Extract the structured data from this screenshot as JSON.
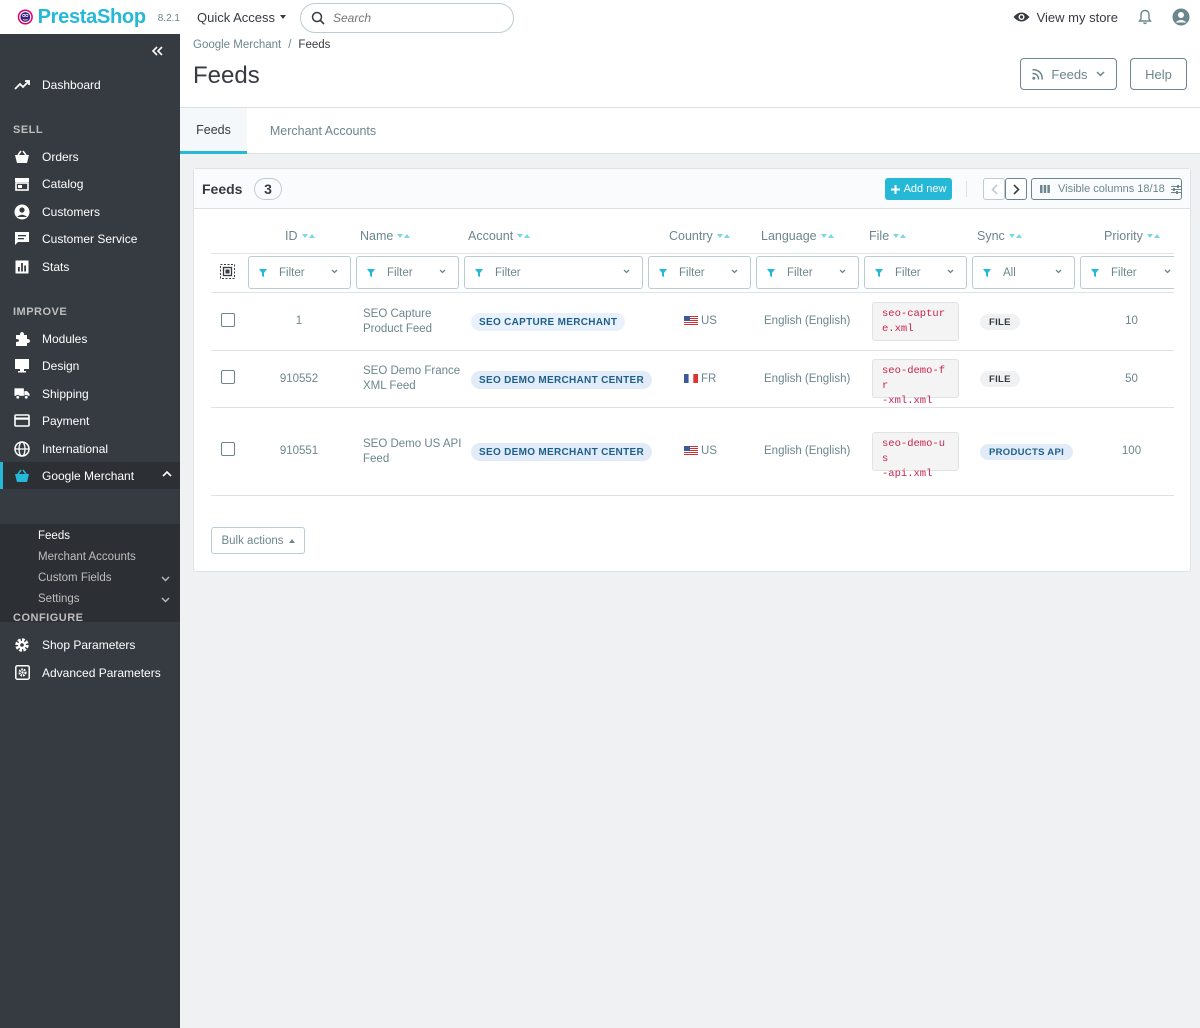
{
  "header": {
    "logo_text": "PrestaShop",
    "version": "8.2.1",
    "quick_access_label": "Quick Access",
    "search_placeholder": "Search",
    "view_store_label": "View my store"
  },
  "sidebar": {
    "dashboard": "Dashboard",
    "sections": {
      "sell": "SELL",
      "improve": "IMPROVE",
      "configure": "CONFIGURE"
    },
    "sell_items": [
      "Orders",
      "Catalog",
      "Customers",
      "Customer Service",
      "Stats"
    ],
    "improve_items": [
      "Modules",
      "Design",
      "Shipping",
      "Payment",
      "International",
      "Google Merchant"
    ],
    "google_merchant_sub": [
      "Feeds",
      "Merchant Accounts",
      "Custom Fields",
      "Settings"
    ],
    "configure_items": [
      "Shop Parameters",
      "Advanced Parameters"
    ]
  },
  "page": {
    "breadcrumb": [
      "Google Merchant",
      "Feeds"
    ],
    "breadcrumb_sep": "/",
    "title": "Feeds",
    "feeds_button": "Feeds",
    "help_button": "Help",
    "tabs": [
      "Feeds",
      "Merchant Accounts"
    ]
  },
  "grid": {
    "title": "Feeds",
    "count": "3",
    "add_new": "Add new",
    "visible_columns": "Visible columns 18/18",
    "columns": [
      "ID",
      "Name",
      "Account",
      "Country",
      "Language",
      "File",
      "Sync",
      "Priority"
    ],
    "filters": [
      "Filter",
      "Filter",
      "Filter",
      "Filter",
      "Filter",
      "Filter",
      "All",
      "Filter"
    ],
    "rows": [
      {
        "id": "1",
        "name_l1": "SEO Capture",
        "name_l2": "Product Feed",
        "account": "SEO CAPTURE MERCHANT",
        "country": "US",
        "language": "English (English)",
        "file_l1": "seo-captur",
        "file_l2": "e.xml",
        "sync": "FILE",
        "priority": "10"
      },
      {
        "id": "910552",
        "name_l1": "SEO Demo France",
        "name_l2": "XML Feed",
        "account": "SEO DEMO MERCHANT CENTER",
        "country": "FR",
        "language": "English (English)",
        "file_l1": "seo-demo-fr",
        "file_l2": "-xml.xml",
        "sync": "FILE",
        "priority": "50"
      },
      {
        "id": "910551",
        "name_l1": "SEO Demo US API",
        "name_l2": "Feed",
        "account": "SEO DEMO MERCHANT CENTER",
        "country": "US",
        "language": "English (English)",
        "file_l1": "seo-demo-us",
        "file_l2": "-api.xml",
        "sync": "PRODUCTS API",
        "priority": "100"
      }
    ],
    "bulk_actions": "Bulk actions"
  },
  "colors": {
    "accent": "#25b9d7",
    "sidebar_bg": "#363a41",
    "page_bg": "#eff1f2"
  }
}
